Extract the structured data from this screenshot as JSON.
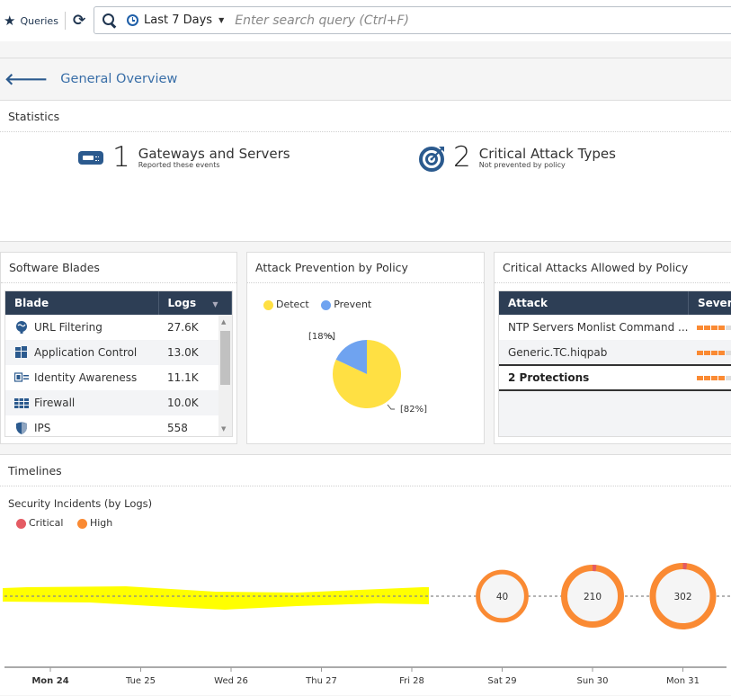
{
  "topbar": {
    "queries_label": "Queries",
    "time_range": "Last 7 Days",
    "search_placeholder": "Enter search query (Ctrl+F)",
    "search_value": ""
  },
  "breadcrumb": {
    "title": "General Overview"
  },
  "statistics": {
    "title": "Statistics",
    "items": [
      {
        "icon": "gateway-icon",
        "count": "1",
        "label": "Gateways and Servers",
        "sub": "Reported these events"
      },
      {
        "icon": "target-icon",
        "count": "2",
        "label": "Critical Attack Types",
        "sub": "Not prevented by policy"
      }
    ]
  },
  "software_blades": {
    "title": "Software Blades",
    "columns": [
      "Blade",
      "Logs"
    ],
    "rows": [
      {
        "icon": "url-filtering-icon",
        "blade": "URL Filtering",
        "logs": "27.6K"
      },
      {
        "icon": "application-control-icon",
        "blade": "Application Control",
        "logs": "13.0K"
      },
      {
        "icon": "identity-awareness-icon",
        "blade": "Identity Awareness",
        "logs": "11.1K"
      },
      {
        "icon": "firewall-icon",
        "blade": "Firewall",
        "logs": "10.0K"
      },
      {
        "icon": "ips-icon",
        "blade": "IPS",
        "logs": "558"
      }
    ]
  },
  "attack_prevention": {
    "title": "Attack Prevention by Policy",
    "colors": {
      "Detect": "#ffe043",
      "Prevent": "#6fa3f0"
    }
  },
  "critical_attacks": {
    "title": "Critical Attacks Allowed by Policy",
    "columns": [
      "Attack",
      "Severity"
    ],
    "rows": [
      {
        "attack": "NTP Servers Monlist Command ...",
        "severity_level": 4,
        "severity_max": 5
      },
      {
        "attack": "Generic.TC.hiqpab",
        "severity_level": 4,
        "severity_max": 5
      }
    ],
    "total": {
      "attack": "2 Protections",
      "severity_level": 4,
      "severity_max": 5
    }
  },
  "timelines": {
    "title": "Timelines",
    "chart_title": "Security Incidents (by Logs)",
    "legend": [
      {
        "name": "Critical",
        "color": "#e45b63"
      },
      {
        "name": "High",
        "color": "#fa8a33"
      }
    ]
  },
  "chart_data": [
    {
      "type": "pie",
      "title": "Attack Prevention by Policy",
      "legend": [
        "Detect",
        "Prevent"
      ],
      "legend_position": "top-left",
      "slices": [
        {
          "name": "Detect",
          "value": 82,
          "label": "[82%]"
        },
        {
          "name": "Prevent",
          "value": 18,
          "label": "[18%]"
        }
      ]
    },
    {
      "type": "scatter",
      "title": "Security Incidents (by Logs)",
      "legend": [
        "Critical",
        "High"
      ],
      "legend_position": "top-left",
      "categories": [
        "Mon 24",
        "Tue 25",
        "Wed 26",
        "Thu 27",
        "Fri 28",
        "Sat 29",
        "Sun 30",
        "Mon 31"
      ],
      "totals": [
        null,
        null,
        null,
        null,
        null,
        40,
        210,
        302
      ],
      "series": [
        {
          "name": "Critical",
          "values": [
            null,
            null,
            null,
            null,
            null,
            0,
            4,
            4
          ]
        },
        {
          "name": "High",
          "values": [
            null,
            null,
            null,
            null,
            null,
            40,
            206,
            298
          ]
        }
      ],
      "highlighted_category": "Mon 24"
    }
  ]
}
